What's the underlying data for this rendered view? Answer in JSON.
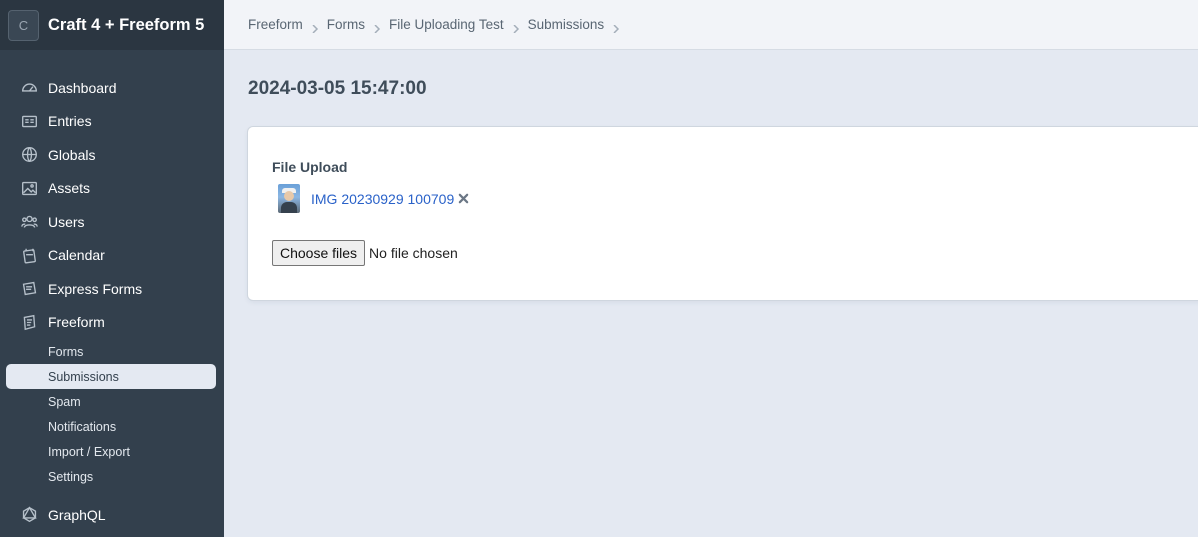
{
  "site": {
    "logo_letter": "C",
    "name": "Craft 4 + Freeform 5"
  },
  "nav": [
    {
      "label": "Dashboard",
      "icon": "dashboard-icon"
    },
    {
      "label": "Entries",
      "icon": "entries-icon"
    },
    {
      "label": "Globals",
      "icon": "globe-icon"
    },
    {
      "label": "Assets",
      "icon": "image-icon"
    },
    {
      "label": "Users",
      "icon": "users-icon"
    },
    {
      "label": "Calendar",
      "icon": "calendar-icon"
    },
    {
      "label": "Express Forms",
      "icon": "express-forms-icon"
    },
    {
      "label": "Freeform",
      "icon": "freeform-icon"
    }
  ],
  "subnav": [
    {
      "label": "Forms"
    },
    {
      "label": "Submissions",
      "active": true
    },
    {
      "label": "Spam"
    },
    {
      "label": "Notifications"
    },
    {
      "label": "Import / Export"
    },
    {
      "label": "Settings"
    }
  ],
  "graphql": {
    "label": "GraphQL",
    "icon": "graphql-icon"
  },
  "breadcrumbs": [
    "Freeform",
    "Forms",
    "File Uploading Test",
    "Submissions"
  ],
  "page": {
    "title": "2024-03-05 15:47:00"
  },
  "field": {
    "label": "File Upload",
    "file_name": "IMG 20230929 100709",
    "choose_label": "Choose files",
    "no_file_text": "No file chosen"
  },
  "colors": {
    "sidebar": "#33404d",
    "content_bg": "#e4e9f2",
    "link": "#2a62c9"
  }
}
